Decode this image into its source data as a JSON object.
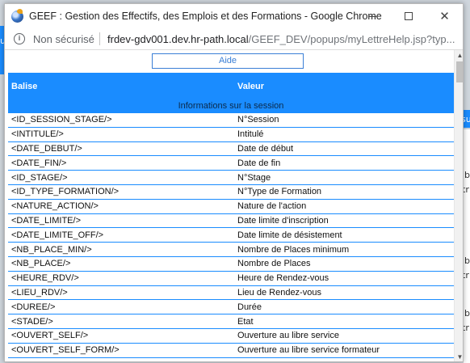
{
  "window": {
    "title": "GEEF : Gestion des Effectifs, des Emplois et des Formations - Google Chrome",
    "controls": {
      "minimize": "minimize-icon",
      "maximize": "maximize-icon",
      "close": "close-icon"
    }
  },
  "address": {
    "security_label": "Non sécurisé",
    "host": "frdev-gdv001.dev.hr-path.local",
    "path": "/GEEF_DEV/popups/myLettreHelp.jsp?typ..."
  },
  "page": {
    "aide_label": "Aide",
    "headers": {
      "balise": "Balise",
      "valeur": "Valeur"
    },
    "section_title": "Informations sur la session",
    "rows": [
      {
        "balise": "<ID_SESSION_STAGE/>",
        "valeur": "N°Session"
      },
      {
        "balise": "<INTITULE/>",
        "valeur": "Intitulé"
      },
      {
        "balise": "<DATE_DEBUT/>",
        "valeur": "Date de début"
      },
      {
        "balise": "<DATE_FIN/>",
        "valeur": "Date de fin"
      },
      {
        "balise": "<ID_STAGE/>",
        "valeur": "N°Stage"
      },
      {
        "balise": "<ID_TYPE_FORMATION/>",
        "valeur": "N°Type de Formation"
      },
      {
        "balise": "<NATURE_ACTION/>",
        "valeur": "Nature de l'action"
      },
      {
        "balise": "<DATE_LIMITE/>",
        "valeur": "Date limite d'inscription"
      },
      {
        "balise": "<DATE_LIMITE_OFF/>",
        "valeur": "Date limite de désistement"
      },
      {
        "balise": "<NB_PLACE_MIN/>",
        "valeur": "Nombre de Places minimum"
      },
      {
        "balise": "<NB_PLACE/>",
        "valeur": "Nombre de Places"
      },
      {
        "balise": "<HEURE_RDV/>",
        "valeur": "Heure de Rendez-vous"
      },
      {
        "balise": "<LIEU_RDV/>",
        "valeur": "Lieu de Rendez-vous"
      },
      {
        "balise": "<DUREE/>",
        "valeur": "Durée"
      },
      {
        "balise": "<STADE/>",
        "valeur": "Etat"
      },
      {
        "balise": "<OUVERT_SELF/>",
        "valeur": "Ouverture au libre service"
      },
      {
        "balise": "<OUVERT_SELF_FORM/>",
        "valeur": "Ouverture au libre service formateur"
      }
    ]
  },
  "background_page": {
    "fragments": [
      "u",
      "su",
      "ib",
      "tr",
      "ib",
      "tr",
      "ib",
      "tr"
    ]
  },
  "colors": {
    "header_blue": "#1a8cff",
    "button_border": "#3b7fd6"
  }
}
